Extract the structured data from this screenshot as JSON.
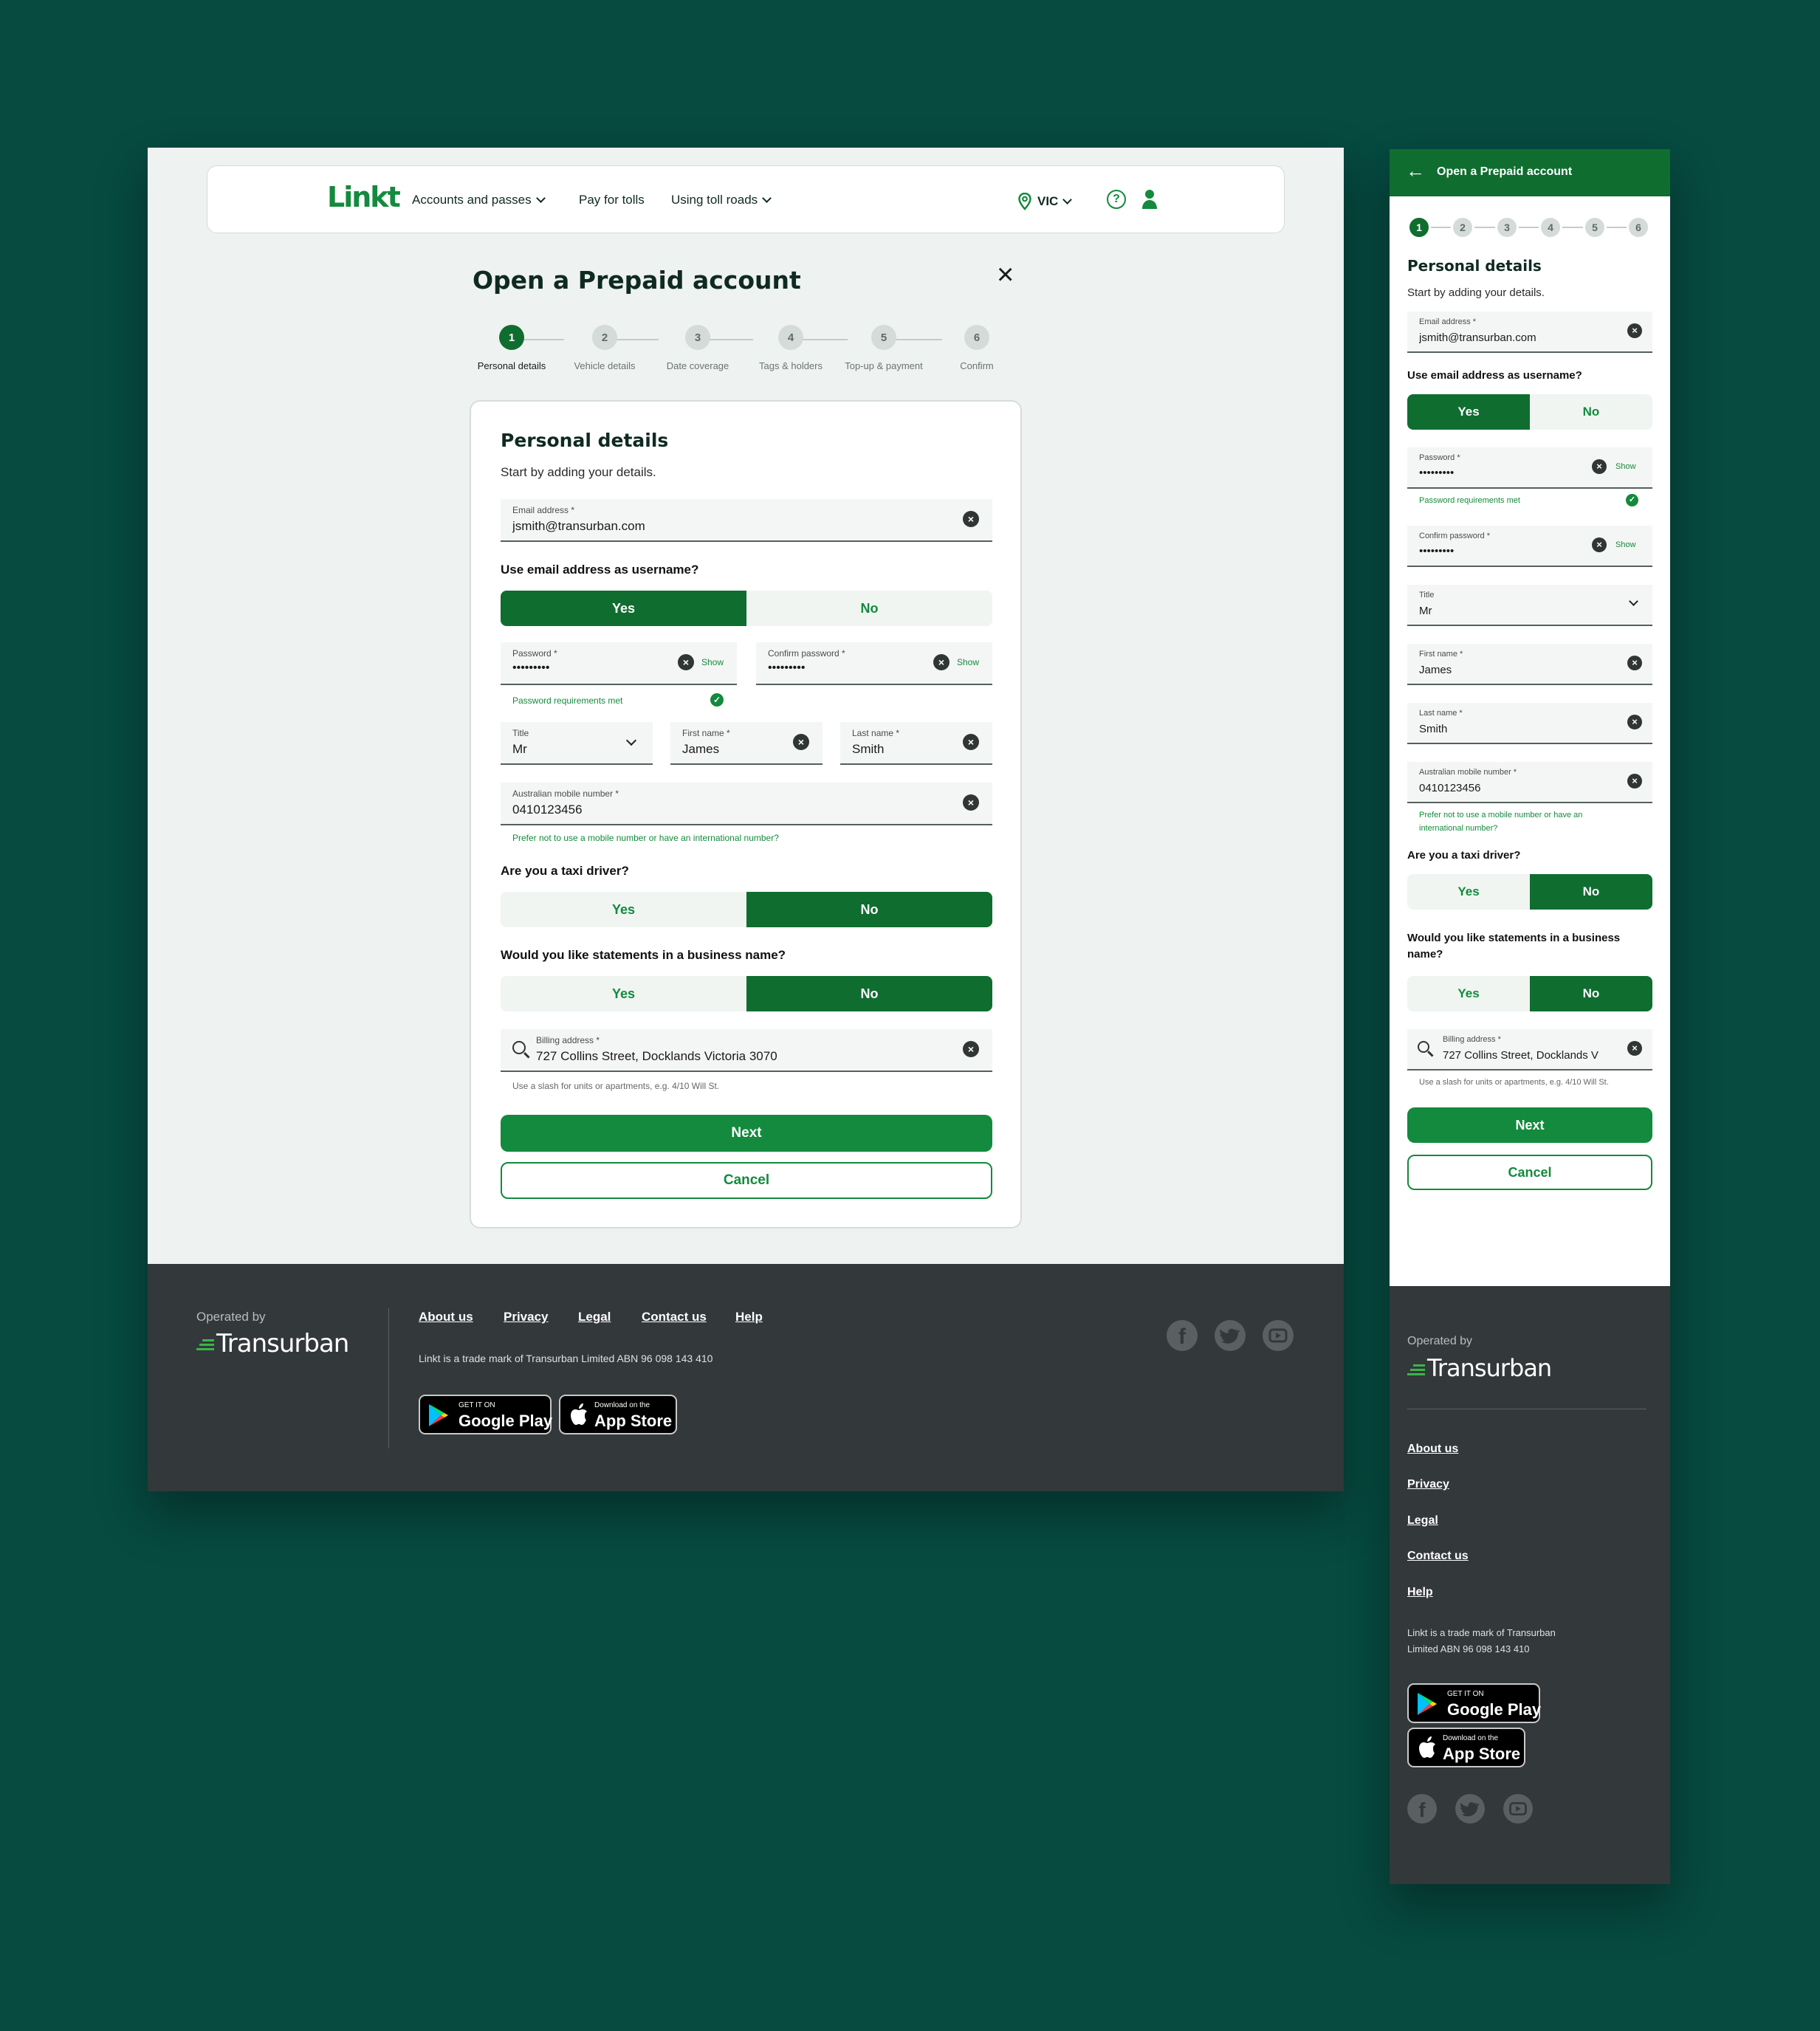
{
  "header": {
    "logo": "Linkt",
    "nav": [
      "Accounts and passes",
      "Pay for tolls",
      "Using toll roads"
    ],
    "state": "VIC",
    "help_icon": "?",
    "user_icon": "user-icon"
  },
  "page": {
    "title": "Open a Prepaid account",
    "steps": [
      {
        "num": "1",
        "label": "Personal details"
      },
      {
        "num": "2",
        "label": "Vehicle details"
      },
      {
        "num": "3",
        "label": "Date coverage"
      },
      {
        "num": "4",
        "label": "Tags & holders"
      },
      {
        "num": "5",
        "label": "Top-up & payment"
      },
      {
        "num": "6",
        "label": "Confirm"
      }
    ],
    "active_step": 1
  },
  "form": {
    "heading": "Personal details",
    "subheading": "Start by adding your details.",
    "email_label": "Email address *",
    "email_value": "jsmith@transurban.com",
    "username_q": "Use email address as username?",
    "yes": "Yes",
    "no": "No",
    "password_label": "Password *",
    "password_value": "•••••••••",
    "confirm_label": "Confirm password *",
    "confirm_value": "•••••••••",
    "show": "Show",
    "password_ok": "Password requirements met",
    "title_label": "Title",
    "title_value": "Mr",
    "first_label": "First name *",
    "first_value": "James",
    "last_label": "Last name *",
    "last_value": "Smith",
    "mobile_label": "Australian mobile number *",
    "mobile_value": "0410123456",
    "mobile_hint": "Prefer not to use a mobile number or have an international number?",
    "taxi_q": "Are you a taxi driver?",
    "business_q": "Would you like statements in a business name?",
    "billing_label": "Billing address *",
    "billing_value": "727 Collins Street, Docklands Victoria 3070",
    "billing_hint": "Use a slash for units or apartments, e.g. 4/10 Will St.",
    "next": "Next",
    "cancel": "Cancel",
    "selections": {
      "username": "Yes",
      "taxi": "No",
      "business": "No"
    }
  },
  "footer": {
    "operated_by": "Operated by",
    "brand": "Transurban",
    "links": [
      "About us",
      "Privacy",
      "Legal",
      "Contact us",
      "Help"
    ],
    "legal": "Linkt is a trade mark of Transurban Limited ABN 96 098 143 410",
    "legal_mobile_1": "Linkt is a trade mark of Transurban",
    "legal_mobile_2": "Limited ABN 96 098 143 410",
    "google_small": "GET IT ON",
    "google_big": "Google Play",
    "apple_small": "Download on the",
    "apple_big": "App Store",
    "social": [
      "facebook-icon",
      "twitter-icon",
      "youtube-icon"
    ]
  },
  "mobile": {
    "back_title": "Open a Prepaid account",
    "mobile_hint_1": "Prefer not to use a mobile number or have an",
    "mobile_hint_2": "international number?",
    "business_q_1": "Would you like statements in a business",
    "business_q_2": "name?",
    "billing_value_short": "727 Collins Street, Docklands V"
  },
  "colors": {
    "background": "#064a40",
    "brand_green": "#138a3d",
    "dark_green": "#0f6d30",
    "footer": "#33383a"
  }
}
